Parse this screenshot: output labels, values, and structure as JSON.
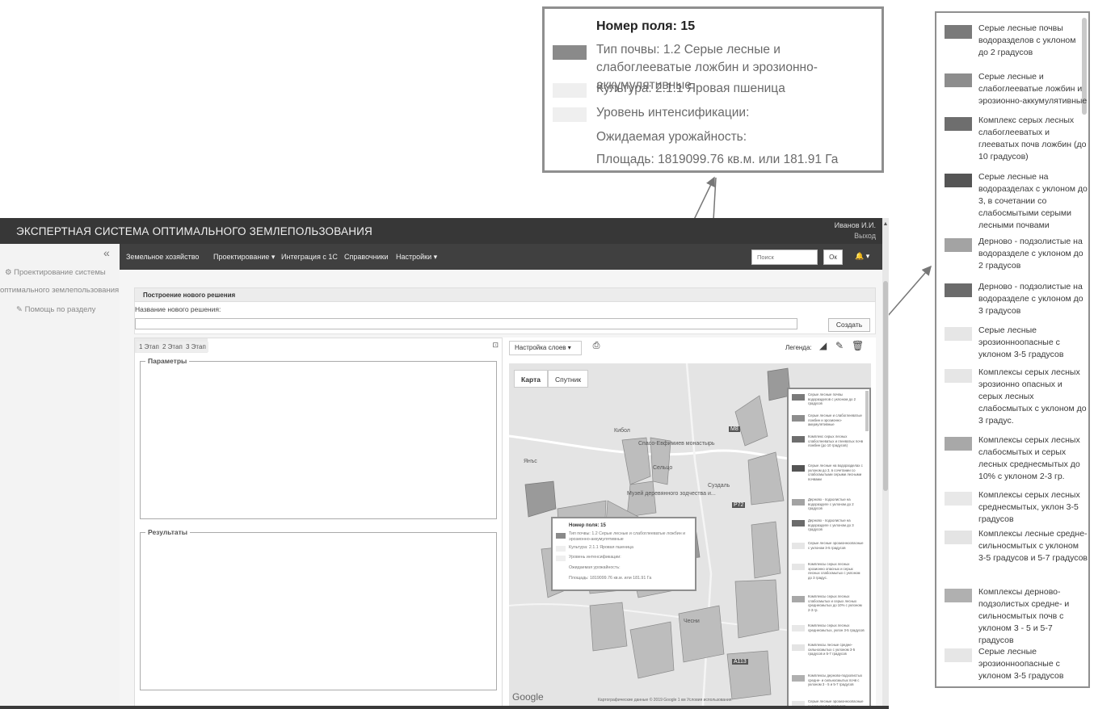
{
  "app": {
    "title": "ЭКСПЕРТНАЯ СИСТЕМА ОПТИМАЛЬНОГО ЗЕМЛЕПОЛЬЗОВАНИЯ",
    "user": "Иванов И.И.",
    "logout": "Выход"
  },
  "sidebar": {
    "collapse_icon": "«",
    "items": [
      {
        "label": "Проектирование системы",
        "icon": "gears-icon"
      },
      {
        "label": "оптимального землепользования"
      },
      {
        "label": "Помощь по разделу",
        "icon": "edit-icon"
      }
    ]
  },
  "nav": {
    "items": [
      "Земельное хозяйство",
      "Проектирование ▾",
      "Интеграция с 1С",
      "Справочники",
      "Настройки ▾"
    ],
    "search_placeholder": "Поиск",
    "search_button": "Ок",
    "bell": "🔔 ▾"
  },
  "panel": {
    "header": "Построение нового решения",
    "name_label": "Название нового решения:",
    "name_value": "",
    "create_button": "Создать"
  },
  "stages": {
    "tabs": [
      "1 Этап",
      "2 Этап",
      "3 Этап"
    ],
    "maximize_icon": "⊡",
    "params_legend": "Параметры",
    "results_legend": "Результаты"
  },
  "map": {
    "layers_button": "Настройка слоев ▾",
    "legend_label": "Легенда:",
    "types": [
      "Карта",
      "Спутник"
    ],
    "place_labels": [
      "Кибол",
      "Спасо-Евфимиев монастырь",
      "Янъс",
      "Сельцо",
      "Суздаль",
      "Музей деревянного зодчества и...",
      "Чесни"
    ],
    "road_labels": [
      "М8",
      "Р72",
      "А113"
    ],
    "google": "Google",
    "attribution": "Картографические данные © 2019 Google   1 км   Условия использования"
  },
  "field_popup": {
    "title": "Номер поля: 15",
    "soil": "Тип почвы: 1.2 Серые лесные и слабоглееватые ложбин и эрозионно-аккумулятивные",
    "crop": "Культура: 2.1.1 Яровая пшеница",
    "intensity": "Уровень интенсификации:",
    "yield": "Ожидаемая урожайность:",
    "area": "Площадь: 1819099.76 кв.м. или 181.91 Га",
    "swatch_colors": [
      "#8a8a8a",
      "#f0f0f0",
      "#f0f0f0"
    ]
  },
  "legend": {
    "items": [
      {
        "text": "Серые  лесные почвы водоразделов с уклоном до 2 градусов",
        "color": "#7a7a7a"
      },
      {
        "text": "Серые лесные и слабоглееватые ложбин и эрозионно-аккумулятивные",
        "color": "#8d8d8d"
      },
      {
        "text": "Комплекс серых лесных слабоглееватых и глееватых почв ложбин (до 10 градусов)",
        "color": "#6e6e6e"
      },
      {
        "text": "Серые  лесные на водоразделах с уклоном до 3, в сочетании со слабосмытыми серыми лесными почвами",
        "color": "#555555"
      },
      {
        "text": "Дерново - подзолистые на водоразделе с уклоном до 2 градусов",
        "color": "#a3a3a3"
      },
      {
        "text": "Дерново - подзолистые на водоразделе с уклоном до 3 градусов",
        "color": "#6b6b6b"
      },
      {
        "text": "Серые лесные эрозионноопасные с уклоном 3-5 градусов",
        "color": "#e6e6e6"
      },
      {
        "text": "Комплексы серых лесных эрозионно опасных и серых лесных слабосмытых с уклоном до 3 градус.",
        "color": "#e6e6e6"
      },
      {
        "text": "Комплексы серых лесных слабосмытых и серых лесных среднесмытых до 10% с уклоном 2-3 гр.",
        "color": "#a8a8a8"
      },
      {
        "text": "Комплексы серых лесных среднесмытых, уклон 3-5 градусов",
        "color": "#e8e8e8"
      },
      {
        "text": "Комплексы лесные средне- сильносмытых с уклоном 3-5 градусов и 5-7 градусов",
        "color": "#e4e4e4"
      },
      {
        "text": "Комплексы дерново-подзолистых средне- и сильносмытых почв с уклоном 3 - 5 и 5-7 градусов",
        "color": "#b0b0b0"
      },
      {
        "text": "Серые лесные эрозионноопасные с уклоном 3-5 градусов",
        "color": "#e6e6e6"
      }
    ]
  }
}
